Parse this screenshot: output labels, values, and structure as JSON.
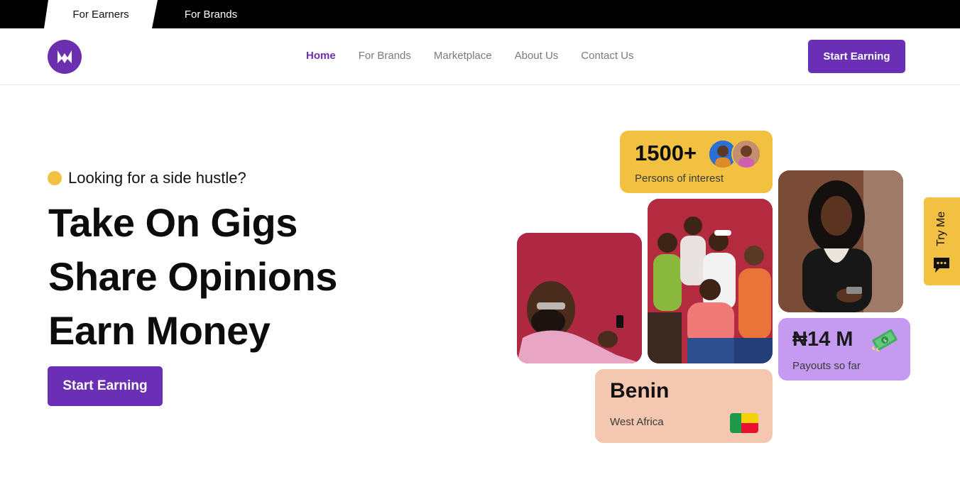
{
  "top_tabs": [
    {
      "label": "For Earners",
      "active": true
    },
    {
      "label": "For Brands",
      "active": false
    }
  ],
  "nav": {
    "logo": "logo-icon",
    "links": [
      {
        "label": "Home",
        "active": true
      },
      {
        "label": "For Brands"
      },
      {
        "label": "Marketplace"
      },
      {
        "label": "About Us"
      },
      {
        "label": "Contact Us"
      }
    ],
    "cta": "Start Earning"
  },
  "hero": {
    "eyebrow": "Looking for a side hustle?",
    "headline": [
      "Take On Gigs",
      "Share Opinions",
      "Earn Money"
    ],
    "cta": "Start Earning"
  },
  "stats": {
    "value": "1500+",
    "label": "Persons of interest"
  },
  "payouts": {
    "value": "₦14 M",
    "label": "Payouts so far",
    "icon": "money-icon"
  },
  "location": {
    "title": "Benin",
    "subtitle": "West Africa",
    "flag": "benin-flag-icon"
  },
  "widget": {
    "label": "Try Me",
    "icon": "chat-icon"
  },
  "colors": {
    "brand_purple": "#6a2fb4",
    "yellow": "#f3c142",
    "lavender": "#c59bf2",
    "peach": "#f4c8b0"
  }
}
